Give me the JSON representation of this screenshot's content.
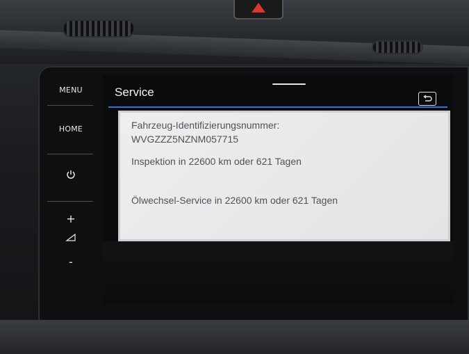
{
  "side_buttons": {
    "menu": "MENU",
    "home": "HOME",
    "plus": "+",
    "minus": "-"
  },
  "screen": {
    "title": "Service",
    "back_icon": "back-arrow-icon",
    "vin_label": "Fahrzeug-Identifizierungsnummer:",
    "vin_value": "WVGZZZ5NZNM057715",
    "inspection": "Inspektion in 22600 km oder 621 Tagen",
    "oil_service": "Ölwechsel-Service in 22600 km oder 621 Tagen"
  },
  "colors": {
    "accent": "#3b6fd6",
    "panel": "#e9e8eb",
    "text": "#4f5257",
    "hazard": "#d8362f"
  }
}
